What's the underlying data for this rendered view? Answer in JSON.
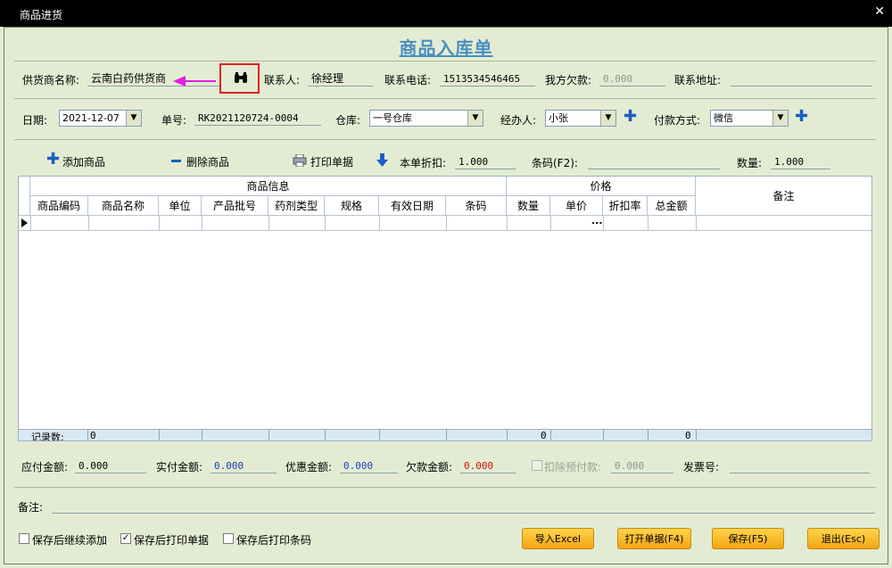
{
  "window": {
    "title": "商品进货",
    "close_glyph": "✕"
  },
  "heading": "商品入库单",
  "supplier": {
    "label": "供货商名称:",
    "value": "云南白药供货商",
    "contact_label": "联系人:",
    "contact_value": "徐经理",
    "phone_label": "联系电话:",
    "phone_value": "1513534546465",
    "debt_label": "我方欠款:",
    "debt_value": "0.000",
    "address_label": "联系地址:",
    "address_value": ""
  },
  "order": {
    "date_label": "日期:",
    "date_value": "2021-12-07",
    "no_label": "单号:",
    "no_value": "RK2021120724-0004",
    "warehouse_label": "仓库:",
    "warehouse_value": "一号仓库",
    "handler_label": "经办人:",
    "handler_value": "小张",
    "payment_label": "付款方式:",
    "payment_value": "微信"
  },
  "toolbar": {
    "add_label": "添加商品",
    "delete_label": "删除商品",
    "print_label": "打印单据",
    "discount_label": "本单折扣:",
    "discount_value": "1.000",
    "barcode_label": "条码(F2):",
    "barcode_value": "",
    "qty_label": "数量:",
    "qty_value": "1.000"
  },
  "table": {
    "group_product": "商品信息",
    "group_price": "价格",
    "remark_header": "备注",
    "columns": [
      "商品编码",
      "商品名称",
      "单位",
      "产品批号",
      "药剂类型",
      "规格",
      "有效日期",
      "条码",
      "数量",
      "单价",
      "折扣率",
      "总金额"
    ],
    "ellipsis": "...",
    "footer_label": "记录数:",
    "footer_count": "0",
    "footer_qty": "0",
    "footer_total": "0"
  },
  "totals": {
    "payable_label": "应付金额:",
    "payable_value": "0.000",
    "paid_label": "实付金额:",
    "paid_value": "0.000",
    "discount_label": "优惠金额:",
    "discount_value": "0.000",
    "owed_label": "欠款金额:",
    "owed_value": "0.000",
    "prepay_label": "扣除预付款:",
    "prepay_value": "0.000",
    "invoice_label": "发票号:",
    "invoice_value": ""
  },
  "remark": {
    "label": "备注:",
    "value": ""
  },
  "options": {
    "continue_label": "保存后继续添加",
    "print_label": "保存后打印单据",
    "barcode_label": "保存后打印条码",
    "print_checked": "✓"
  },
  "buttons": {
    "excel": "导入Excel",
    "open": "打开单据(F4)",
    "save": "保存(F5)",
    "exit": "退出(Esc)"
  },
  "colors": {
    "heading": "#4a8fc1",
    "paid": "#1a3ec2",
    "owed": "#d01010",
    "button": "#f3a514",
    "annotation": "#e020e0",
    "highlight": "#e02020"
  }
}
